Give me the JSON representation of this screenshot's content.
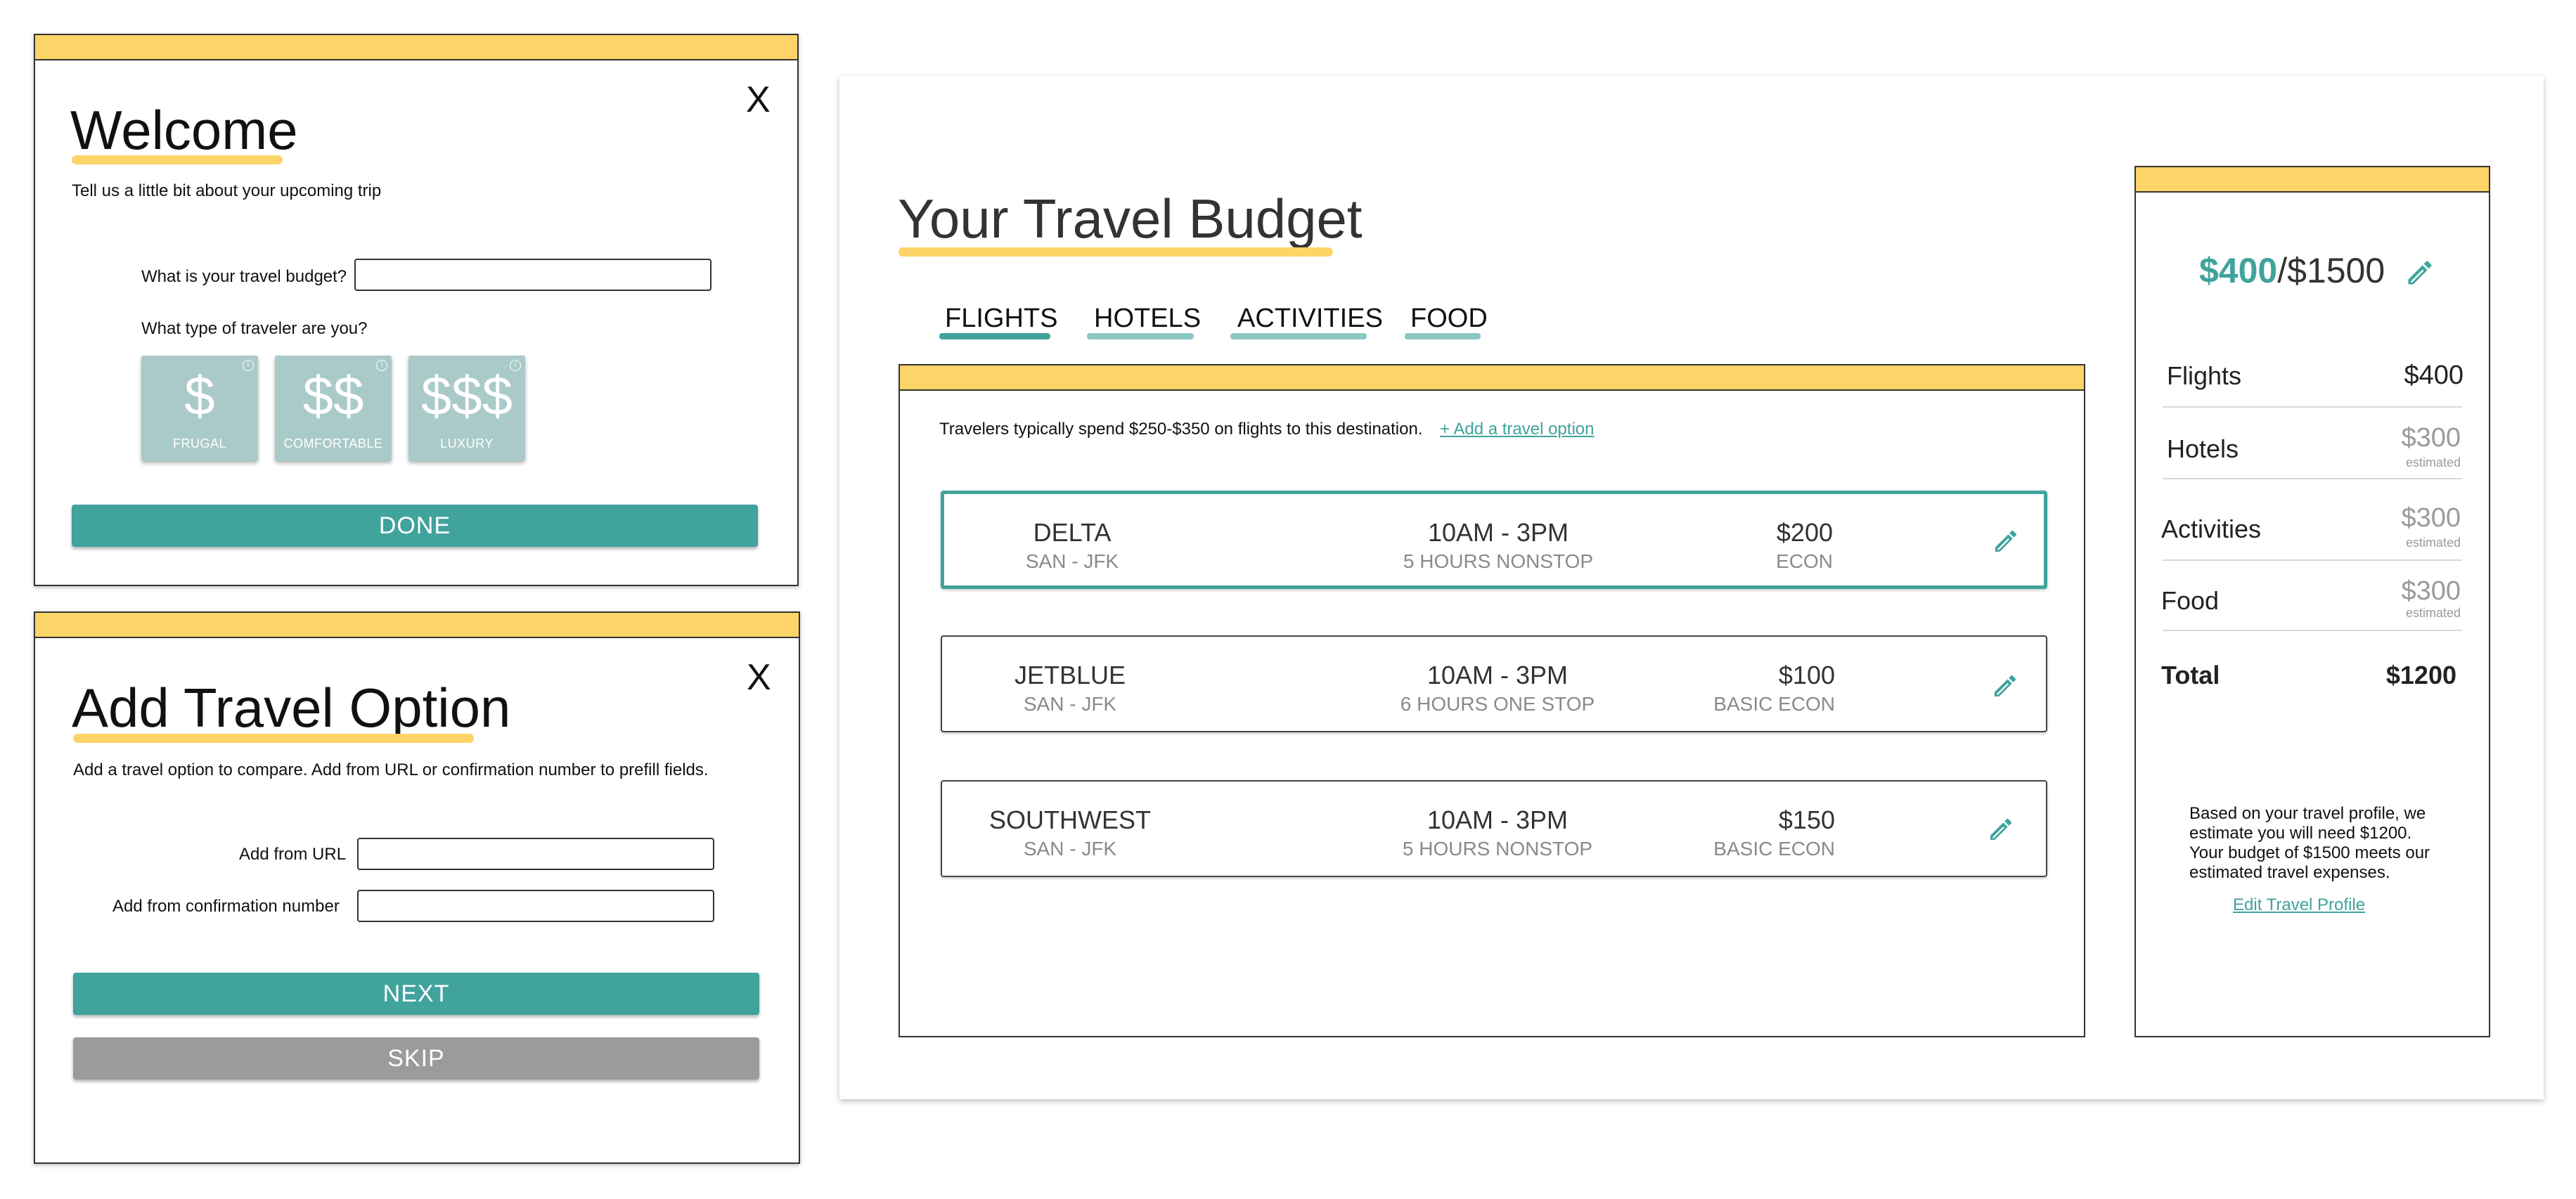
{
  "colors": {
    "accent": "#40a39c",
    "highlight": "#fdd467",
    "tier": "#a9cac9",
    "muted": "#9b9b9b"
  },
  "welcome_modal": {
    "title": "Welcome",
    "close": "X",
    "subtitle": "Tell us a little bit about your upcoming trip",
    "budget_label": "What is your travel budget?",
    "budget_value": "",
    "type_label": "What type of traveler are you?",
    "tiers": [
      {
        "symbol": "$",
        "label": "FRUGAL"
      },
      {
        "symbol": "$$",
        "label": "COMFORTABLE"
      },
      {
        "symbol": "$$$",
        "label": "LUXURY"
      }
    ],
    "done": "DONE"
  },
  "add_modal": {
    "title": "Add Travel Option",
    "close": "X",
    "subtitle": "Add a travel option to compare. Add from URL or confirmation number to prefill fields.",
    "url_label": "Add from URL",
    "url_value": "",
    "conf_label": "Add from confirmation number",
    "conf_value": "",
    "next": "NEXT",
    "skip": "SKIP"
  },
  "budget": {
    "title": "Your Travel Budget",
    "tabs": [
      {
        "label": "FLIGHTS",
        "active": true
      },
      {
        "label": "HOTELS",
        "active": false
      },
      {
        "label": "ACTIVITIES",
        "active": false
      },
      {
        "label": "FOOD",
        "active": false
      }
    ],
    "info_text": "Travelers  typically spend $250-$350 on flights to this destination.",
    "add_option_link": "+ Add a travel option",
    "flights": [
      {
        "airline": "DELTA",
        "route": "SAN - JFK",
        "time": "10AM - 3PM",
        "duration": "5 HOURS NONSTOP",
        "price": "$200",
        "class": "ECON",
        "selected": true
      },
      {
        "airline": "JETBLUE",
        "route": "SAN - JFK",
        "time": "10AM - 3PM",
        "duration": "6 HOURS ONE STOP",
        "price": "$100",
        "class": "BASIC ECON",
        "selected": false
      },
      {
        "airline": "SOUTHWEST",
        "route": "SAN - JFK",
        "time": "10AM - 3PM",
        "duration": "5 HOURS NONSTOP",
        "price": "$150",
        "class": "BASIC ECON",
        "selected": false
      }
    ],
    "summary": {
      "spent": "$400",
      "total_budget": "/$1500",
      "rows": [
        {
          "label": "Flights",
          "value": "$400",
          "note": ""
        },
        {
          "label": "Hotels",
          "value": "$300",
          "note": "estimated"
        },
        {
          "label": "Activities",
          "value": "$300",
          "note": "estimated"
        },
        {
          "label": "Food",
          "value": "$300",
          "note": "estimated"
        }
      ],
      "total_label": "Total",
      "total_value": "$1200",
      "note_lines": [
        "Based on your travel profile, we",
        "estimate you will need $1200.",
        "Your budget of $1500 meets our",
        "estimated travel expenses."
      ],
      "edit_link": "Edit Travel Profile"
    }
  }
}
